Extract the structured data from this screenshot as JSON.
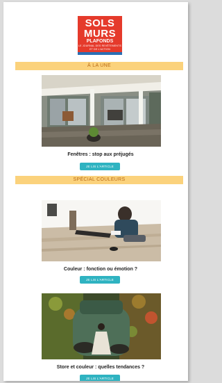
{
  "header": {
    "logo_line1": "SOLS",
    "logo_line2": "MURS",
    "logo_line3": "PLAFONDS",
    "logo_tagline": "LE JOURNAL DES REVÊTEMENTS ET DE L'ACTION"
  },
  "sections": {
    "a_la_une": "À LA UNE",
    "special_couleurs": "SPÉCIAL COULEURS"
  },
  "articles": [
    {
      "title": "Fenêtres : stop aux préjugés",
      "button_label": "JE LIS L'ARTICLE",
      "image_icon": "terrace-photo"
    },
    {
      "title": "Couleur : fonction ou émotion ?",
      "button_label": "JE LIS L'ARTICLE",
      "image_icon": "floor-installer-photo"
    },
    {
      "title": "Store et couleur : quelles tendances ?",
      "button_label": "JE LIS L'ARTICLE",
      "image_icon": "green-interior-photo"
    }
  ],
  "colors": {
    "section_bar": "#fbd27c",
    "button": "#2fb3c1",
    "logo_red": "#e53a2b",
    "logo_blue": "#2a6fb4"
  }
}
